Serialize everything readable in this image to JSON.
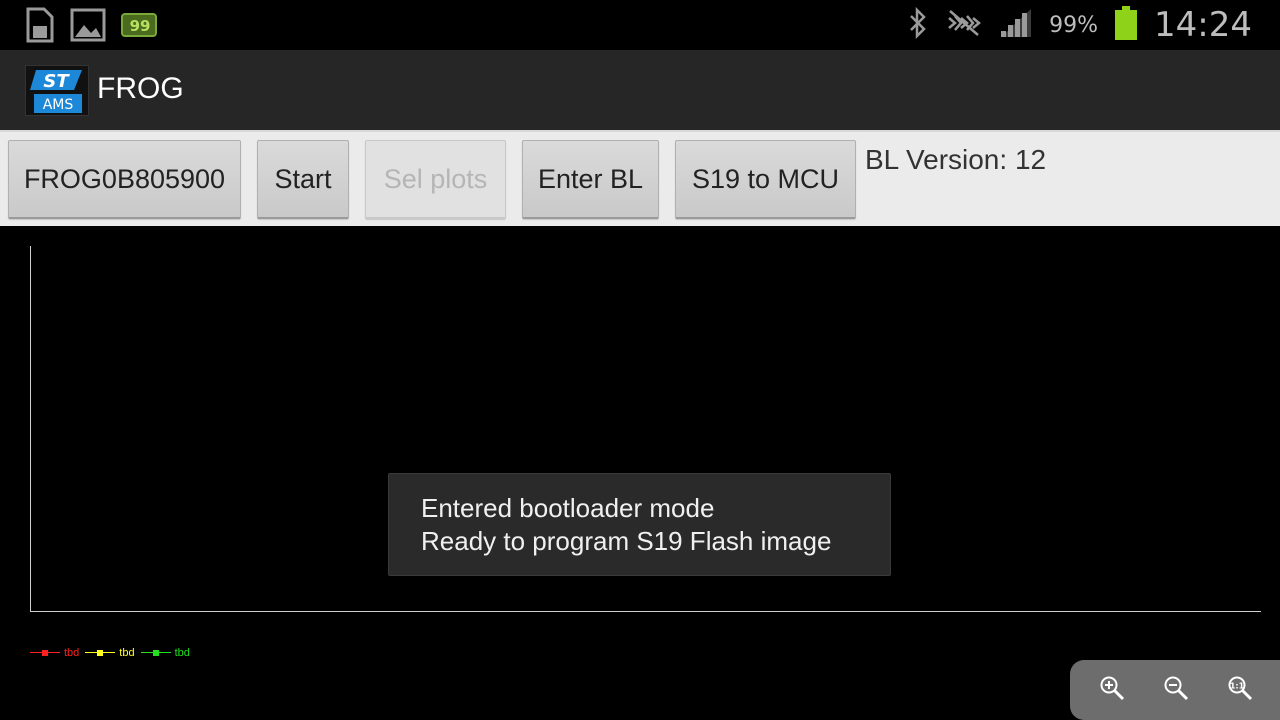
{
  "status_bar": {
    "notification_icons": [
      "sd-card-icon",
      "gallery-icon",
      "battery-notification-icon"
    ],
    "notification_badge": "99",
    "battery_percent": "99%",
    "time": "14:24"
  },
  "action_bar": {
    "title": "FROG"
  },
  "toolbar": {
    "device_button": "FROG0B805900",
    "start_button": "Start",
    "sel_plots_button": "Sel plots",
    "enter_bl_button": "Enter BL",
    "s19_button": "S19 to MCU",
    "bl_version": "BL Version: 12"
  },
  "legend": [
    {
      "label": "tbd",
      "color": "#ff2020"
    },
    {
      "label": "tbd",
      "color": "#ffff20"
    },
    {
      "label": "tbd",
      "color": "#20e020"
    }
  ],
  "toast": {
    "line1": "Entered bootloader mode",
    "line2": "Ready to program S19 Flash image"
  },
  "zoom_controls": [
    "zoom-in-icon",
    "zoom-out-icon",
    "zoom-reset-icon"
  ]
}
